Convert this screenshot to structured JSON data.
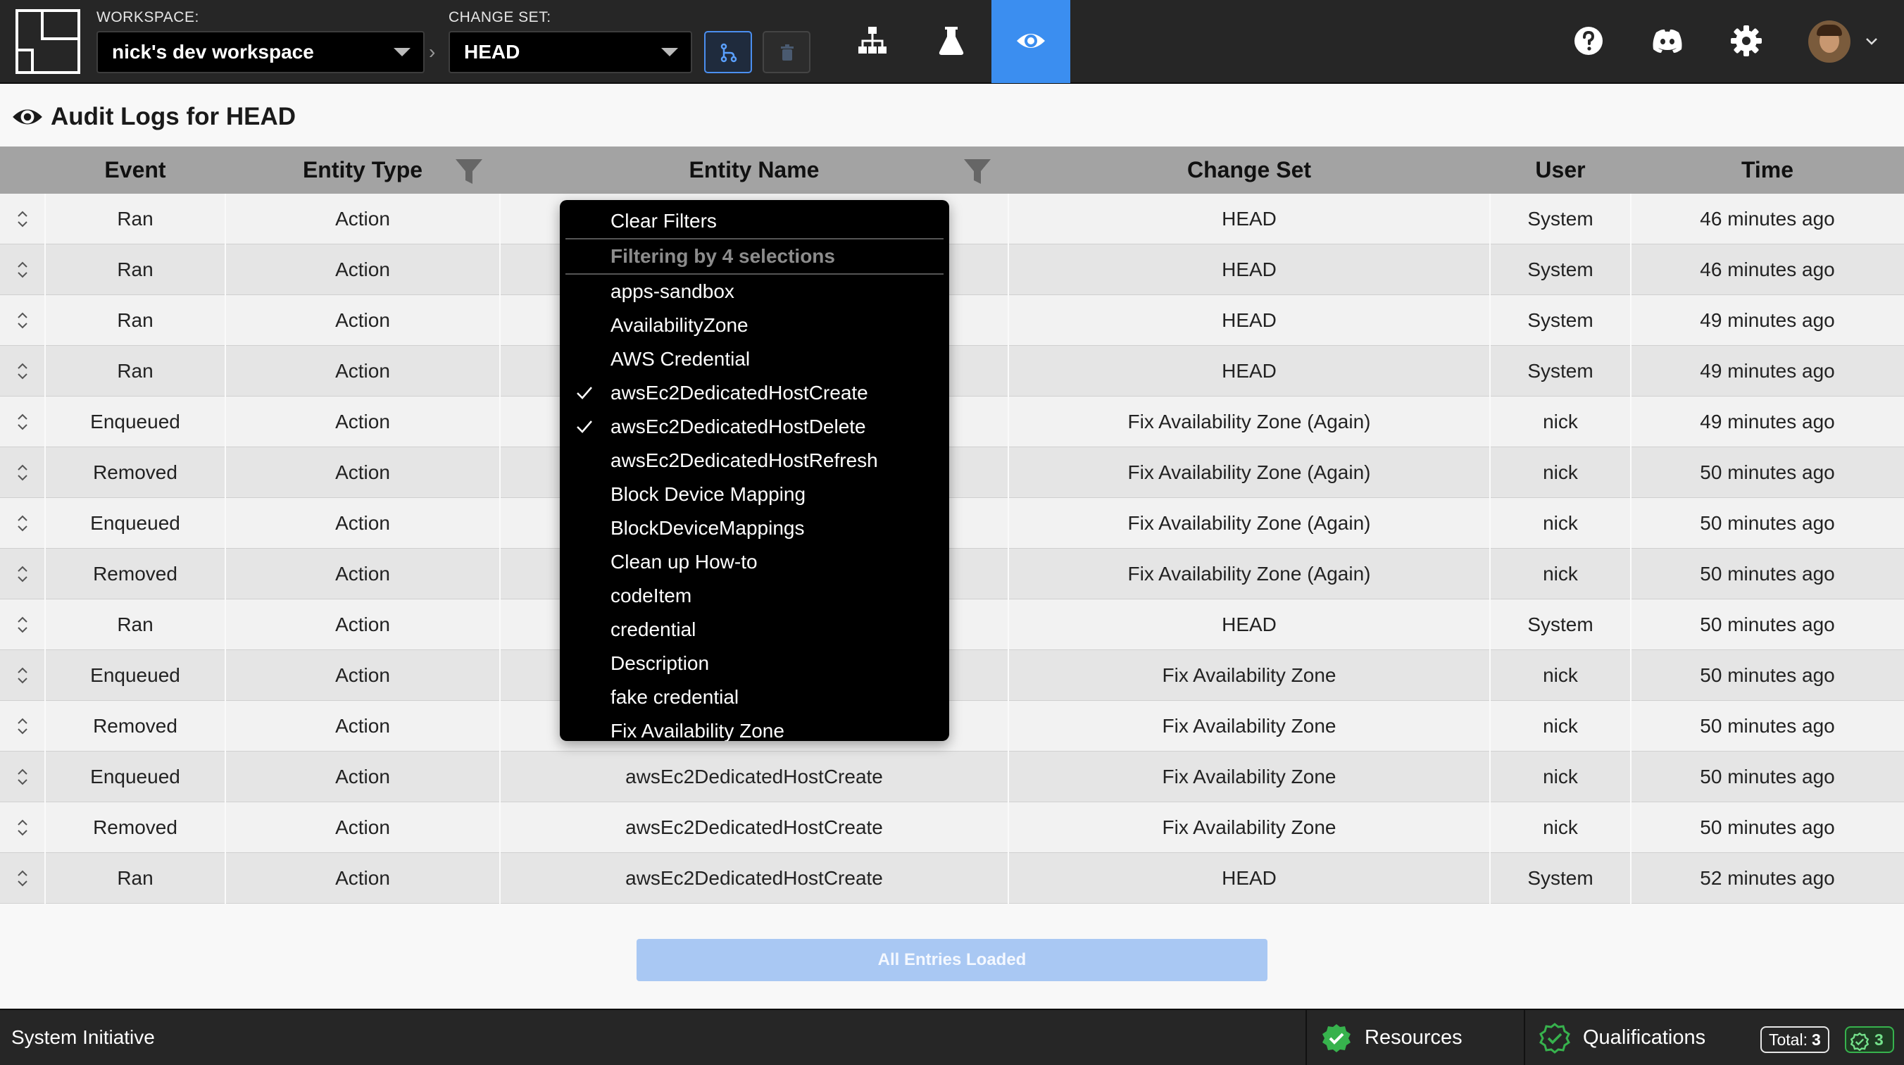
{
  "header": {
    "workspace_label": "WORKSPACE:",
    "workspace_value": "nick's dev workspace",
    "changeset_label": "CHANGE SET:",
    "changeset_value": "HEAD"
  },
  "page": {
    "title": "Audit Logs for HEAD"
  },
  "table": {
    "columns": [
      "Event",
      "Entity Type",
      "Entity Name",
      "Change Set",
      "User",
      "Time"
    ],
    "rows": [
      {
        "event": "Ran",
        "entity_type": "Action",
        "entity_name": "",
        "change_set": "HEAD",
        "user": "System",
        "time": "46 minutes ago"
      },
      {
        "event": "Ran",
        "entity_type": "Action",
        "entity_name": "",
        "change_set": "HEAD",
        "user": "System",
        "time": "46 minutes ago"
      },
      {
        "event": "Ran",
        "entity_type": "Action",
        "entity_name": "",
        "change_set": "HEAD",
        "user": "System",
        "time": "49 minutes ago"
      },
      {
        "event": "Ran",
        "entity_type": "Action",
        "entity_name": "",
        "change_set": "HEAD",
        "user": "System",
        "time": "49 minutes ago"
      },
      {
        "event": "Enqueued",
        "entity_type": "Action",
        "entity_name": "",
        "change_set": "Fix Availability Zone (Again)",
        "user": "nick",
        "time": "49 minutes ago"
      },
      {
        "event": "Removed",
        "entity_type": "Action",
        "entity_name": "",
        "change_set": "Fix Availability Zone (Again)",
        "user": "nick",
        "time": "50 minutes ago"
      },
      {
        "event": "Enqueued",
        "entity_type": "Action",
        "entity_name": "",
        "change_set": "Fix Availability Zone (Again)",
        "user": "nick",
        "time": "50 minutes ago"
      },
      {
        "event": "Removed",
        "entity_type": "Action",
        "entity_name": "",
        "change_set": "Fix Availability Zone (Again)",
        "user": "nick",
        "time": "50 minutes ago"
      },
      {
        "event": "Ran",
        "entity_type": "Action",
        "entity_name": "",
        "change_set": "HEAD",
        "user": "System",
        "time": "50 minutes ago"
      },
      {
        "event": "Enqueued",
        "entity_type": "Action",
        "entity_name": "",
        "change_set": "Fix Availability Zone",
        "user": "nick",
        "time": "50 minutes ago"
      },
      {
        "event": "Removed",
        "entity_type": "Action",
        "entity_name": "",
        "change_set": "Fix Availability Zone",
        "user": "nick",
        "time": "50 minutes ago"
      },
      {
        "event": "Enqueued",
        "entity_type": "Action",
        "entity_name": "awsEc2DedicatedHostCreate",
        "change_set": "Fix Availability Zone",
        "user": "nick",
        "time": "50 minutes ago"
      },
      {
        "event": "Removed",
        "entity_type": "Action",
        "entity_name": "awsEc2DedicatedHostCreate",
        "change_set": "Fix Availability Zone",
        "user": "nick",
        "time": "50 minutes ago"
      },
      {
        "event": "Ran",
        "entity_type": "Action",
        "entity_name": "awsEc2DedicatedHostCreate",
        "change_set": "HEAD",
        "user": "System",
        "time": "52 minutes ago"
      }
    ]
  },
  "filter_dropdown": {
    "clear_label": "Clear Filters",
    "heading": "Filtering by 4 selections",
    "options": [
      {
        "label": "apps-sandbox",
        "checked": false
      },
      {
        "label": "AvailabilityZone",
        "checked": false
      },
      {
        "label": "AWS Credential",
        "checked": false
      },
      {
        "label": "awsEc2DedicatedHostCreate",
        "checked": true
      },
      {
        "label": "awsEc2DedicatedHostDelete",
        "checked": true
      },
      {
        "label": "awsEc2DedicatedHostRefresh",
        "checked": false
      },
      {
        "label": "Block Device Mapping",
        "checked": false
      },
      {
        "label": "BlockDeviceMappings",
        "checked": false
      },
      {
        "label": "Clean up How-to",
        "checked": false
      },
      {
        "label": "codeItem",
        "checked": false
      },
      {
        "label": "credential",
        "checked": false
      },
      {
        "label": "Description",
        "checked": false
      },
      {
        "label": "fake credential",
        "checked": false
      },
      {
        "label": "Fix Availability Zone",
        "checked": false
      }
    ]
  },
  "load_button": {
    "label": "All Entries Loaded"
  },
  "status_bar": {
    "brand": "System Initiative",
    "resources_label": "Resources",
    "qualifications_label": "Qualifications",
    "total_label": "Total:",
    "total_value": "3",
    "ok_count": "3"
  },
  "icons": [
    "logo",
    "chevron-right-icon",
    "caret-down-icon",
    "branch-icon",
    "trash-icon",
    "diagram-icon",
    "beaker-icon",
    "eye-icon",
    "help-icon",
    "discord-icon",
    "gear-icon",
    "avatar",
    "filter-icon",
    "sort-icon",
    "check-icon",
    "shield-check-icon"
  ],
  "colors": {
    "accent": "#3b8ef0",
    "topbar": "#262626",
    "success": "#37b24d"
  }
}
